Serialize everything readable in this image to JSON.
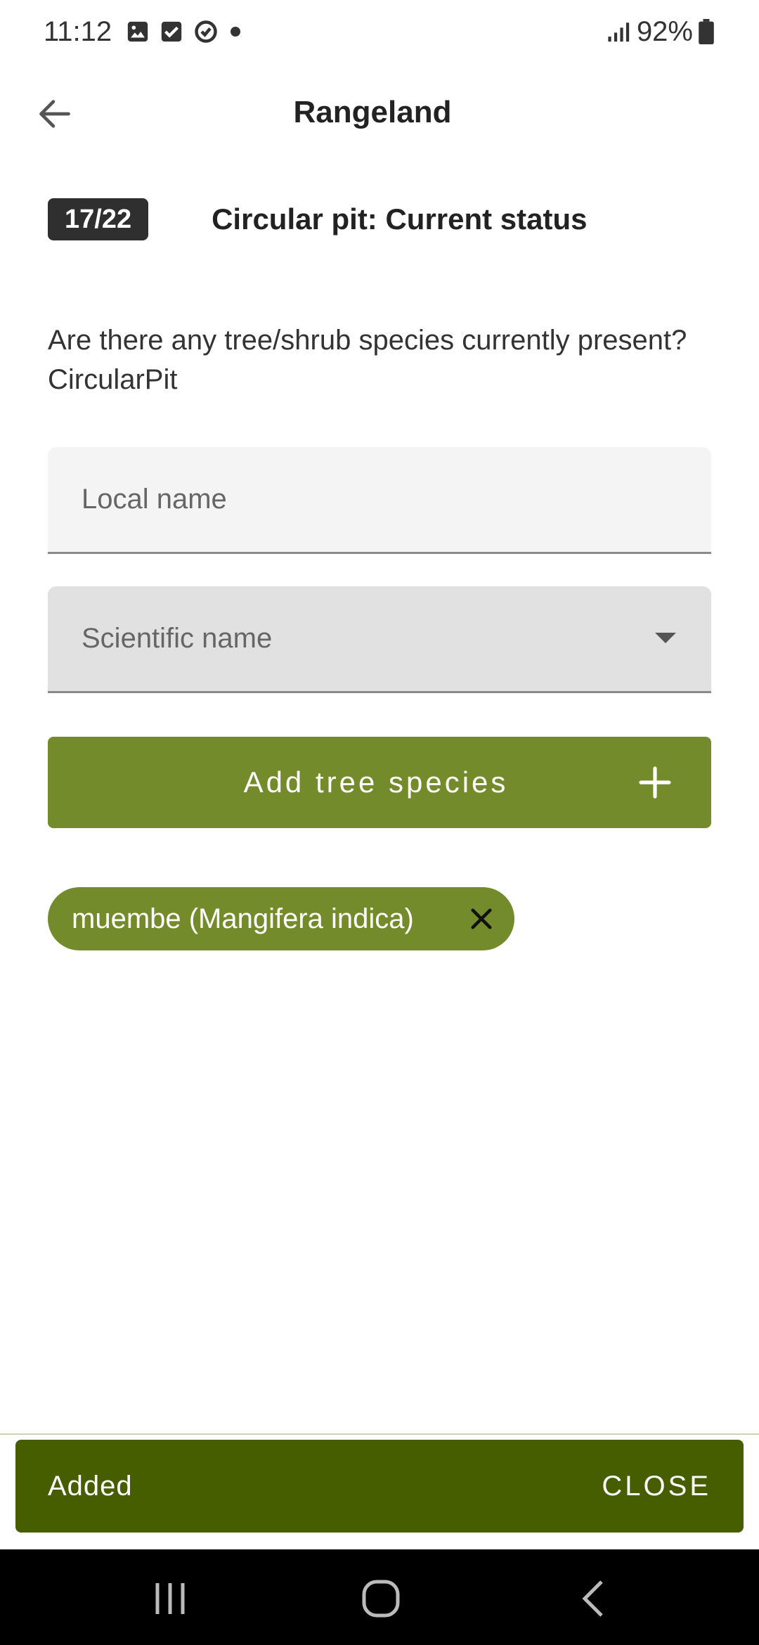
{
  "status_bar": {
    "time": "11:12",
    "battery": "92%",
    "icons": [
      "image-icon",
      "checkbox-icon",
      "sync-icon",
      "dot-icon",
      "signal-icon",
      "battery-icon"
    ]
  },
  "app_bar": {
    "title": "Rangeland",
    "back_icon": "arrow-left-icon"
  },
  "question": {
    "counter": "17/22",
    "section_title": "Circular pit: Current status",
    "text": "Are there any tree/shrub species currently present? CircularPit"
  },
  "form": {
    "local_name_placeholder": "Local name",
    "local_name_value": "",
    "scientific_name_placeholder": "Scientific name",
    "add_button_label": "Add tree species"
  },
  "chips": [
    {
      "label": "muembe (Mangifera indica)"
    }
  ],
  "snackbar": {
    "message": "Added",
    "action": "CLOSE"
  },
  "colors": {
    "accent": "#748b2c",
    "snackbar": "#465e00",
    "badge": "#2f2f2f"
  }
}
